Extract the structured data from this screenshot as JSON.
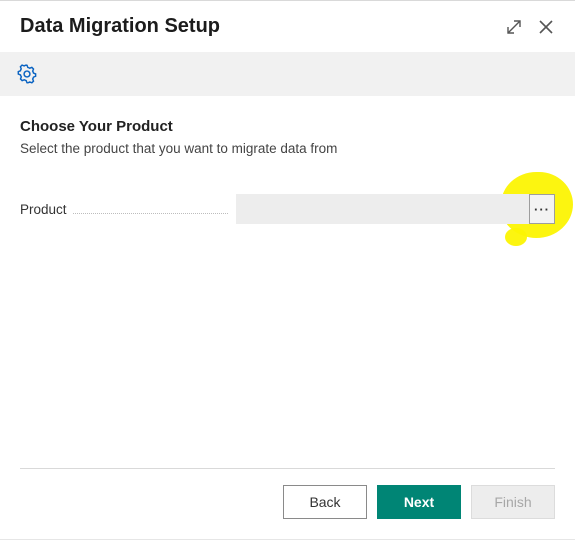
{
  "header": {
    "title": "Data Migration Setup"
  },
  "section": {
    "heading": "Choose Your Product",
    "subtitle": "Select the product that you want to migrate data from"
  },
  "field": {
    "label": "Product",
    "value": "",
    "lookup_label": "···"
  },
  "footer": {
    "back": "Back",
    "next": "Next",
    "finish": "Finish"
  }
}
